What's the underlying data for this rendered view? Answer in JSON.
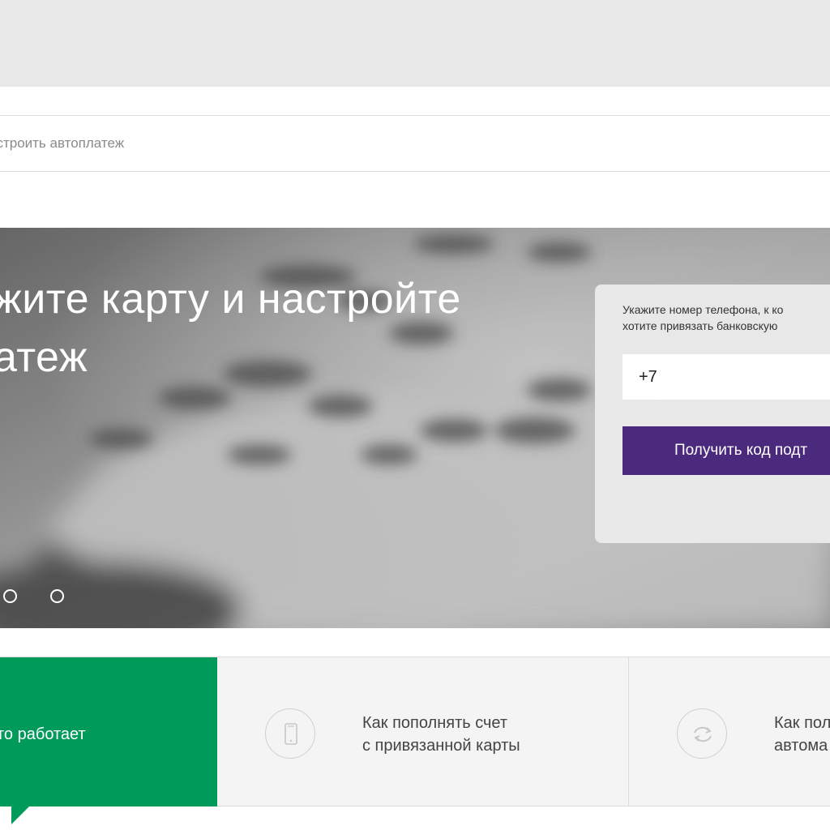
{
  "breadcrumb": {
    "text": "астроить автоплатеж"
  },
  "hero": {
    "title_line1": "жите карту и настройте",
    "title_line2": "атеж",
    "slides": {
      "count": 2
    }
  },
  "form": {
    "prompt_line1": "Укажите номер телефона, к ко",
    "prompt_line2": "хотите привязать банковскую",
    "phone_value": "+7",
    "button_label": "Получить код подт"
  },
  "tabs": [
    {
      "label": "то работает",
      "active": true
    },
    {
      "label_line1": "Как пополнять счет",
      "label_line2": "с привязанной карты",
      "icon": "phone-icon",
      "active": false
    },
    {
      "label_line1": "Как пол",
      "label_line2": "автома",
      "icon": "refresh-icon",
      "active": false
    }
  ],
  "colors": {
    "accent_green": "#009a5b",
    "accent_purple": "#4b2a7d",
    "top_band": "#e8e8e8"
  }
}
